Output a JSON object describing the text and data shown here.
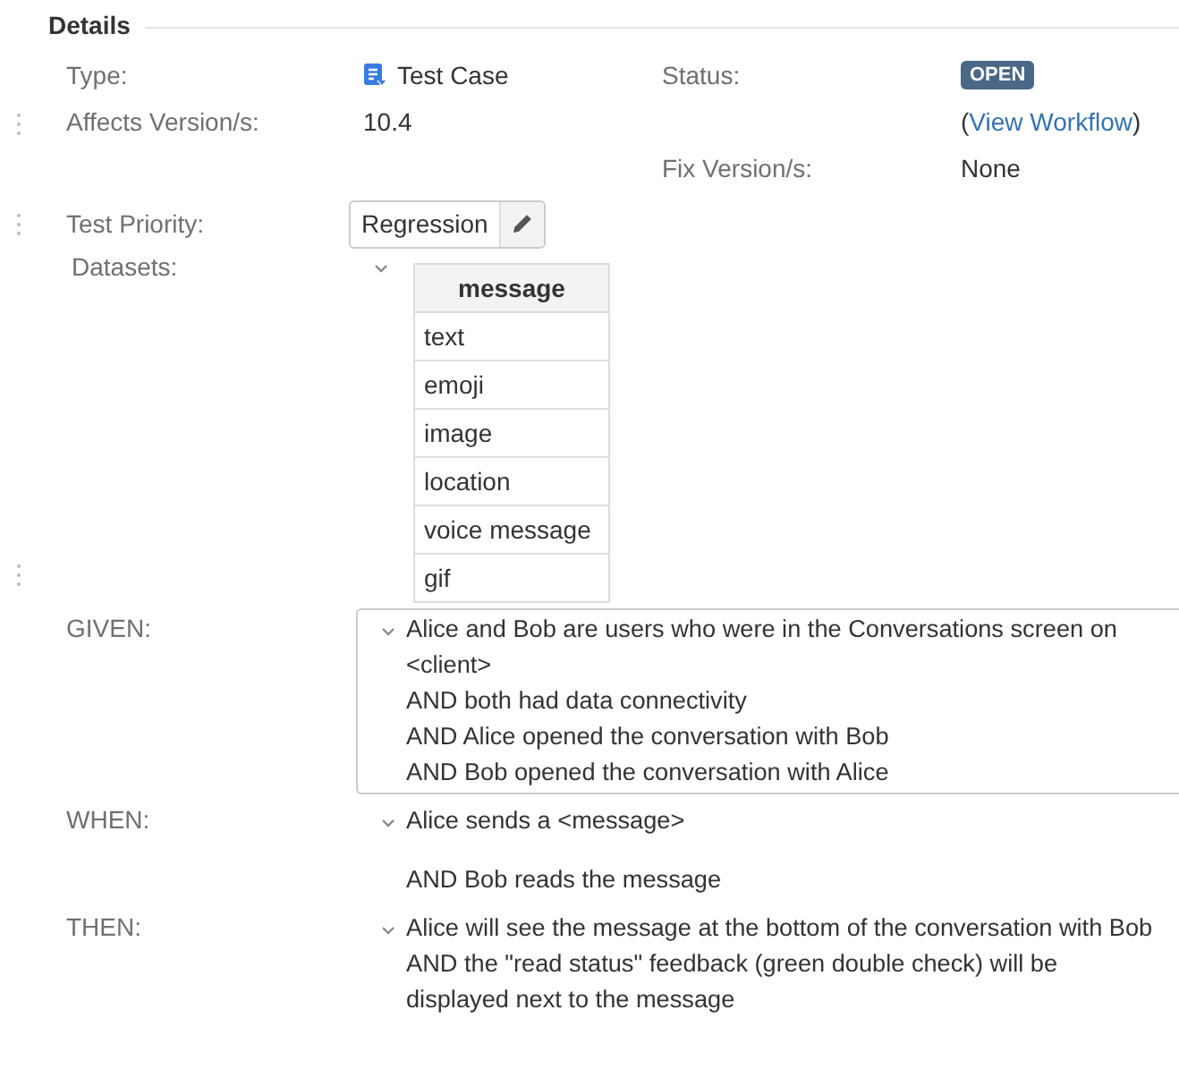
{
  "section": {
    "title": "Details"
  },
  "field_rows": [
    {
      "left": {
        "label": "Type:",
        "value": "Test Case",
        "kind": "type"
      },
      "right": {
        "label": "Status:",
        "value": "OPEN",
        "kind": "status"
      }
    },
    {
      "left": {
        "label": "Affects Version/s:",
        "value": "10.4",
        "kind": "text"
      },
      "right": {
        "value": "View Workflow",
        "prefix": "(",
        "suffix": ")",
        "kind": "link"
      }
    },
    {
      "right": {
        "label": "Fix Version/s:",
        "value": "None",
        "kind": "text"
      }
    }
  ],
  "test_priority": {
    "label": "Test Priority:",
    "value": "Regression"
  },
  "datasets": {
    "label": "Datasets:",
    "expanded": true,
    "columns": [
      "message"
    ],
    "rows": [
      "text",
      "emoji",
      "image",
      "location",
      "voice message",
      "gif"
    ]
  },
  "steps": [
    {
      "label": "GIVEN:",
      "boxed": true,
      "expanded": true,
      "lines": [
        "Alice and Bob are users who were in the Conversations screen on <client>",
        "AND both had data connectivity",
        "AND Alice opened the conversation with Bob",
        "AND Bob opened the conversation with Alice"
      ]
    },
    {
      "label": "WHEN:",
      "boxed": false,
      "expanded": true,
      "lines": [
        "Alice sends a <message>",
        "AND Bob reads the message"
      ]
    },
    {
      "label": "THEN:",
      "boxed": false,
      "expanded": true,
      "lines": [
        "Alice will see the message at the bottom of the conversation with Bob",
        "AND the \"read status\" feedback (green double check) will be displayed next to the message"
      ]
    }
  ]
}
